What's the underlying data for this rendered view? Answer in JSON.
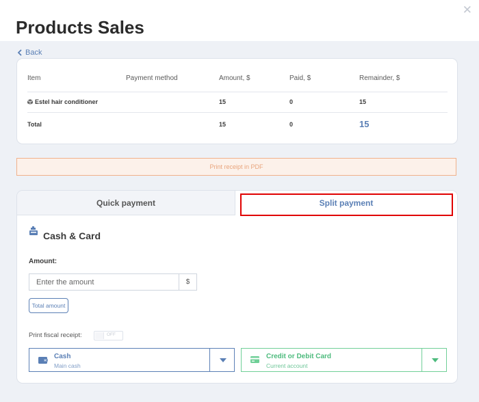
{
  "header": {
    "title": "Products Sales",
    "close_icon": "close-icon"
  },
  "nav": {
    "back_label": "Back"
  },
  "table": {
    "columns": [
      "Item",
      "Payment method",
      "Amount, $",
      "Paid, $",
      "Remainder, $"
    ],
    "rows": [
      {
        "item": "Estel hair conditioner",
        "payment_method": "",
        "amount": "15",
        "paid": "0",
        "remainder": "15"
      }
    ],
    "total": {
      "label": "Total",
      "amount": "15",
      "paid": "0",
      "remainder": "15"
    }
  },
  "print_pdf_label": "Print receipt in PDF",
  "tabs": [
    {
      "label": "Quick payment",
      "active": false
    },
    {
      "label": "Split payment",
      "active": true
    }
  ],
  "payment": {
    "title": "Cash & Card",
    "amount_label": "Amount:",
    "amount_placeholder": "Enter the amount",
    "currency": "$",
    "total_amount_button": "Total amount",
    "fiscal_label": "Print fiscal receipt:",
    "fiscal_toggle": "OFF",
    "cash_select": {
      "label": "Cash",
      "sub": "Main cash"
    },
    "card_select": {
      "label": "Credit or Debit Card",
      "sub": "Current account"
    }
  },
  "colors": {
    "accent": "#5a7fb5",
    "green": "#4dbb7d",
    "highlight": "#e00000",
    "pdf_border": "#f0b18a"
  }
}
